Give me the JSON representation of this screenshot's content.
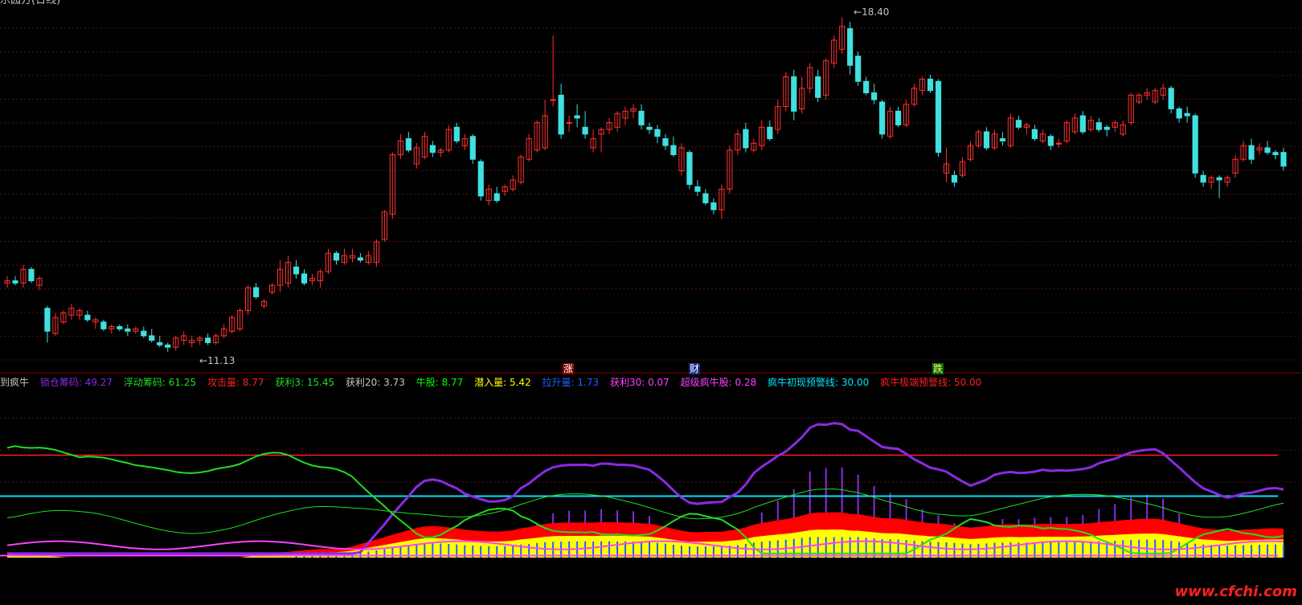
{
  "app": {
    "title": "乐园方(日线)",
    "watermark": "www.cfchi.com"
  },
  "colors": {
    "background": "#000000",
    "grid": "#5a1010",
    "separator": "#8b0000",
    "up_candle": "#ff3030",
    "down_candle": "#40e0e0",
    "lock_chip": "#8a2be2",
    "float_chip": "#22dd22",
    "profit20": "#c8c8c8",
    "bull_stock": "#00ff00",
    "hidden_inflow": "#ffff00",
    "lift_volume": "#1e60ff",
    "profit30": "#ff40ff",
    "warn_initial": "#00e5ff",
    "warn_extreme": "#ff2020",
    "fill_red": "#ff0000",
    "fill_yellow": "#ffff00"
  },
  "main": {
    "high_label": "18.40",
    "low_label": "11.13",
    "high_arrow": "←",
    "low_arrow": "←",
    "signals": [
      {
        "text": "涨",
        "bg": "#8b0000",
        "color": "#ffffff"
      },
      {
        "text": "财",
        "bg": "#1e2a8a",
        "color": "#ffffff"
      },
      {
        "text": "跌",
        "bg": "#0a6a0a",
        "color": "#ffff66"
      }
    ]
  },
  "indicator": {
    "legend": [
      {
        "text": "到疯牛",
        "color": "#c8c8c8"
      },
      {
        "text": "锁仓筹码: 49.27",
        "color": "#8a2be2"
      },
      {
        "text": "浮动筹码: 61.25",
        "color": "#22dd22"
      },
      {
        "text": "攻击量: 8.77",
        "color": "#ff2020"
      },
      {
        "text": "获利3: 15.45",
        "color": "#22dd22"
      },
      {
        "text": "获利20: 3.73",
        "color": "#c8c8c8"
      },
      {
        "text": "牛股: 8.77",
        "color": "#00ff00"
      },
      {
        "text": "潜入量: 5.42",
        "color": "#ffff00"
      },
      {
        "text": "拉升量: 1.73",
        "color": "#1e60ff"
      },
      {
        "text": "获利30: 0.07",
        "color": "#ff40ff"
      },
      {
        "text": "超级疯牛股: 0.28",
        "color": "#ff40ff"
      },
      {
        "text": "疯牛初现预警线: 30.00",
        "color": "#00e5ff"
      },
      {
        "text": "疯牛极端预警线: 50.00",
        "color": "#ff2020"
      }
    ]
  },
  "chart_data": [
    {
      "type": "candlestick",
      "title": "",
      "high_marker": 18.4,
      "low_marker": 11.13,
      "ylim": [
        10.8,
        18.6
      ],
      "bars_ohlc": [
        [
          12.6,
          12.75,
          12.5,
          12.65
        ],
        [
          12.65,
          12.75,
          12.55,
          12.6
        ],
        [
          12.6,
          13.0,
          12.5,
          12.9
        ],
        [
          12.9,
          12.95,
          12.6,
          12.65
        ],
        [
          12.55,
          12.75,
          12.45,
          12.7
        ],
        [
          12.05,
          12.1,
          11.3,
          11.55
        ],
        [
          11.5,
          11.95,
          11.45,
          11.85
        ],
        [
          11.75,
          12.0,
          11.7,
          11.95
        ],
        [
          11.9,
          12.15,
          11.8,
          12.05
        ],
        [
          11.9,
          12.05,
          11.8,
          12.0
        ],
        [
          11.9,
          12.0,
          11.75,
          11.8
        ],
        [
          11.75,
          11.85,
          11.6,
          11.8
        ],
        [
          11.75,
          11.8,
          11.55,
          11.6
        ],
        [
          11.6,
          11.7,
          11.5,
          11.65
        ],
        [
          11.65,
          11.7,
          11.55,
          11.6
        ],
        [
          11.6,
          11.7,
          11.45,
          11.55
        ],
        [
          11.55,
          11.65,
          11.5,
          11.6
        ],
        [
          11.55,
          11.65,
          11.4,
          11.45
        ],
        [
          11.45,
          11.6,
          11.3,
          11.35
        ],
        [
          11.3,
          11.45,
          11.2,
          11.25
        ],
        [
          11.25,
          11.3,
          11.1,
          11.2
        ],
        [
          11.2,
          11.45,
          11.13,
          11.4
        ],
        [
          11.35,
          11.55,
          11.25,
          11.45
        ],
        [
          11.3,
          11.45,
          11.2,
          11.35
        ],
        [
          11.35,
          11.45,
          11.25,
          11.4
        ],
        [
          11.4,
          11.5,
          11.25,
          11.3
        ],
        [
          11.3,
          11.5,
          11.25,
          11.45
        ],
        [
          11.45,
          11.7,
          11.4,
          11.6
        ],
        [
          11.55,
          11.9,
          11.5,
          11.85
        ],
        [
          11.6,
          12.05,
          11.55,
          12.0
        ],
        [
          12.0,
          12.55,
          11.9,
          12.5
        ],
        [
          12.5,
          12.6,
          12.25,
          12.3
        ],
        [
          12.1,
          12.25,
          12.05,
          12.2
        ],
        [
          12.4,
          12.6,
          12.35,
          12.55
        ],
        [
          12.55,
          13.1,
          12.4,
          12.9
        ],
        [
          12.6,
          13.2,
          12.5,
          13.05
        ],
        [
          12.95,
          13.1,
          12.7,
          12.8
        ],
        [
          12.8,
          12.9,
          12.55,
          12.6
        ],
        [
          12.65,
          12.8,
          12.55,
          12.7
        ],
        [
          12.65,
          12.9,
          12.5,
          12.85
        ],
        [
          12.85,
          13.35,
          12.8,
          13.25
        ],
        [
          13.25,
          13.3,
          13.0,
          13.1
        ],
        [
          13.05,
          13.35,
          13.0,
          13.2
        ],
        [
          13.15,
          13.35,
          13.05,
          13.2
        ],
        [
          13.15,
          13.25,
          13.05,
          13.1
        ],
        [
          13.05,
          13.3,
          13.0,
          13.2
        ],
        [
          13.05,
          13.55,
          12.95,
          13.5
        ],
        [
          13.55,
          14.2,
          13.5,
          14.15
        ],
        [
          14.1,
          15.45,
          14.0,
          15.4
        ],
        [
          15.4,
          15.85,
          15.3,
          15.7
        ],
        [
          15.75,
          15.9,
          15.45,
          15.5
        ],
        [
          15.2,
          15.65,
          15.1,
          15.55
        ],
        [
          15.35,
          15.9,
          15.3,
          15.8
        ],
        [
          15.6,
          15.7,
          15.35,
          15.45
        ],
        [
          15.45,
          15.55,
          15.35,
          15.5
        ],
        [
          15.5,
          16.05,
          15.45,
          15.95
        ],
        [
          16.0,
          16.1,
          15.65,
          15.7
        ],
        [
          15.6,
          15.85,
          15.5,
          15.75
        ],
        [
          15.8,
          15.85,
          15.2,
          15.3
        ],
        [
          15.25,
          15.3,
          14.4,
          14.5
        ],
        [
          14.4,
          14.75,
          14.3,
          14.65
        ],
        [
          14.55,
          14.7,
          14.35,
          14.4
        ],
        [
          14.6,
          14.75,
          14.5,
          14.7
        ],
        [
          14.65,
          14.95,
          14.6,
          14.85
        ],
        [
          14.8,
          15.4,
          14.75,
          15.35
        ],
        [
          15.3,
          15.85,
          15.25,
          15.75
        ],
        [
          15.5,
          16.15,
          15.45,
          16.1
        ],
        [
          15.55,
          16.6,
          15.5,
          16.25
        ],
        [
          16.6,
          18.0,
          16.45,
          16.6
        ],
        [
          16.7,
          16.95,
          15.75,
          15.85
        ],
        [
          16.1,
          16.25,
          15.9,
          16.1
        ],
        [
          16.25,
          16.5,
          16.0,
          16.2
        ],
        [
          16.0,
          16.35,
          15.75,
          15.85
        ],
        [
          15.55,
          15.95,
          15.45,
          15.75
        ],
        [
          15.85,
          16.0,
          15.45,
          15.95
        ],
        [
          15.95,
          16.2,
          15.85,
          16.1
        ],
        [
          16.0,
          16.35,
          15.9,
          16.3
        ],
        [
          16.2,
          16.45,
          16.05,
          16.35
        ],
        [
          16.35,
          16.5,
          16.2,
          16.4
        ],
        [
          16.35,
          16.5,
          15.95,
          16.05
        ],
        [
          16.0,
          16.1,
          15.85,
          15.95
        ],
        [
          15.95,
          16.05,
          15.65,
          15.8
        ],
        [
          15.75,
          15.85,
          15.5,
          15.6
        ],
        [
          15.6,
          15.8,
          15.35,
          15.4
        ],
        [
          15.05,
          15.65,
          14.95,
          15.55
        ],
        [
          15.45,
          15.5,
          14.65,
          14.75
        ],
        [
          14.7,
          14.85,
          14.5,
          14.6
        ],
        [
          14.55,
          14.65,
          14.3,
          14.35
        ],
        [
          14.35,
          14.45,
          14.1,
          14.2
        ],
        [
          14.2,
          14.75,
          14.0,
          14.65
        ],
        [
          14.65,
          15.6,
          14.55,
          15.5
        ],
        [
          15.5,
          15.95,
          15.4,
          15.85
        ],
        [
          15.95,
          16.1,
          15.45,
          15.55
        ],
        [
          15.5,
          15.75,
          15.45,
          15.65
        ],
        [
          15.6,
          16.15,
          15.5,
          16.0
        ],
        [
          16.0,
          16.15,
          15.7,
          15.75
        ],
        [
          15.95,
          16.6,
          15.85,
          16.45
        ],
        [
          16.45,
          17.2,
          16.35,
          17.1
        ],
        [
          17.1,
          17.25,
          16.15,
          16.35
        ],
        [
          16.4,
          17.1,
          16.3,
          16.85
        ],
        [
          16.85,
          17.4,
          16.75,
          17.3
        ],
        [
          17.1,
          17.25,
          16.55,
          16.65
        ],
        [
          16.7,
          17.5,
          16.6,
          17.45
        ],
        [
          17.4,
          18.0,
          17.3,
          17.9
        ],
        [
          17.7,
          18.4,
          17.6,
          18.2
        ],
        [
          18.15,
          18.3,
          17.15,
          17.35
        ],
        [
          17.55,
          17.65,
          16.9,
          17.0
        ],
        [
          17.0,
          17.1,
          16.7,
          16.75
        ],
        [
          16.75,
          16.95,
          16.5,
          16.6
        ],
        [
          16.55,
          16.6,
          15.75,
          15.85
        ],
        [
          15.8,
          16.45,
          15.75,
          16.35
        ],
        [
          16.35,
          16.45,
          16.0,
          16.05
        ],
        [
          16.05,
          16.6,
          16.0,
          16.5
        ],
        [
          16.5,
          16.95,
          16.45,
          16.85
        ],
        [
          16.8,
          17.1,
          16.7,
          17.05
        ],
        [
          17.05,
          17.15,
          16.75,
          16.8
        ],
        [
          17.0,
          17.05,
          15.35,
          15.45
        ],
        [
          15.0,
          15.55,
          14.8,
          15.2
        ],
        [
          14.95,
          15.05,
          14.7,
          14.8
        ],
        [
          14.95,
          15.35,
          14.9,
          15.25
        ],
        [
          15.3,
          15.7,
          15.25,
          15.6
        ],
        [
          15.6,
          15.95,
          15.55,
          15.9
        ],
        [
          15.9,
          16.0,
          15.5,
          15.55
        ],
        [
          15.55,
          15.95,
          15.5,
          15.85
        ],
        [
          15.75,
          15.9,
          15.6,
          15.7
        ],
        [
          15.6,
          16.3,
          15.55,
          16.2
        ],
        [
          16.15,
          16.25,
          15.95,
          16.0
        ],
        [
          16.0,
          16.1,
          15.85,
          16.05
        ],
        [
          15.95,
          16.05,
          15.7,
          15.75
        ],
        [
          15.7,
          15.95,
          15.65,
          15.85
        ],
        [
          15.8,
          15.85,
          15.5,
          15.6
        ],
        [
          15.65,
          15.75,
          15.55,
          15.65
        ],
        [
          15.7,
          16.15,
          15.65,
          16.1
        ],
        [
          15.9,
          16.3,
          15.85,
          16.2
        ],
        [
          16.25,
          16.35,
          15.85,
          15.9
        ],
        [
          15.95,
          16.25,
          15.9,
          16.15
        ],
        [
          16.1,
          16.2,
          15.9,
          15.95
        ],
        [
          16.0,
          16.05,
          15.8,
          15.95
        ],
        [
          16.0,
          16.15,
          15.9,
          16.1
        ],
        [
          15.85,
          16.15,
          15.8,
          16.05
        ],
        [
          16.1,
          16.75,
          16.05,
          16.7
        ],
        [
          16.55,
          16.75,
          16.5,
          16.7
        ],
        [
          16.7,
          16.85,
          16.6,
          16.75
        ],
        [
          16.55,
          16.85,
          16.5,
          16.8
        ],
        [
          16.7,
          16.95,
          16.6,
          16.85
        ],
        [
          16.85,
          16.9,
          16.3,
          16.4
        ],
        [
          16.4,
          16.45,
          16.1,
          16.2
        ],
        [
          16.3,
          16.45,
          16.1,
          16.25
        ],
        [
          16.25,
          16.3,
          14.9,
          15.0
        ],
        [
          14.95,
          15.05,
          14.7,
          14.8
        ],
        [
          14.8,
          14.95,
          14.65,
          14.9
        ],
        [
          14.9,
          14.95,
          14.45,
          14.85
        ],
        [
          14.8,
          14.95,
          14.7,
          14.9
        ],
        [
          15.0,
          15.4,
          14.9,
          15.3
        ],
        [
          15.3,
          15.7,
          15.25,
          15.6
        ],
        [
          15.6,
          15.75,
          15.2,
          15.3
        ],
        [
          15.5,
          15.65,
          15.4,
          15.55
        ],
        [
          15.55,
          15.7,
          15.4,
          15.45
        ],
        [
          15.45,
          15.5,
          15.3,
          15.4
        ],
        [
          15.45,
          15.55,
          15.05,
          15.15
        ]
      ]
    },
    {
      "type": "indicator",
      "title": "",
      "ylim": [
        0,
        80
      ],
      "reference_lines": [
        {
          "name": "疯牛初现预警线",
          "value": 30
        },
        {
          "name": "疯牛极端预警线",
          "value": 50
        }
      ],
      "series": [
        {
          "name": "锁仓筹码",
          "values": [
            45,
            44.5,
            44,
            43.5,
            43,
            42.5,
            42,
            41.5,
            41,
            40.5,
            40,
            39.5,
            39,
            38.5,
            38,
            37.5,
            37,
            36.5,
            36,
            35.5,
            35,
            34.5,
            34,
            33.5,
            33,
            32.5,
            32,
            31.5,
            31,
            30.5,
            30,
            29.5,
            29,
            28.5,
            28,
            27.5,
            27,
            26.5,
            26,
            25.5,
            25,
            24.5,
            24,
            23.5,
            23,
            22.5,
            22,
            21.5,
            21,
            20.5,
            20,
            19.5,
            19,
            18.5,
            18,
            17.5,
            17,
            16.5,
            16,
            15.5,
            15,
            14.5,
            14,
            13.5,
            13,
            12.5,
            12,
            11.5,
            11,
            10.5,
            10,
            9.5,
            9,
            8.5,
            8,
            7.5,
            7,
            6.5,
            6,
            5.5,
            5,
            4.5,
            4,
            3.5,
            3,
            2.5,
            2,
            1.5,
            1,
            0.5,
            0,
            0,
            0,
            0,
            0,
            0,
            0,
            0,
            0,
            0,
            0,
            0,
            0,
            0,
            0,
            0,
            0,
            0,
            0,
            0,
            0,
            0,
            0,
            0,
            0,
            0,
            0,
            0,
            0,
            0,
            0,
            0,
            0,
            0,
            0,
            0,
            0,
            0,
            0,
            0,
            0,
            0,
            0,
            0,
            0,
            0,
            0,
            0,
            0,
            0,
            0,
            0,
            0,
            0,
            0,
            0,
            0,
            0,
            0,
            0
          ]
        }
      ],
      "note_values": {
        "锁仓筹码": 49.27,
        "浮动筹码": 61.25,
        "攻击量": 8.77,
        "获利3": 15.45,
        "获利20": 3.73,
        "牛股": 8.77,
        "潜入量": 5.42,
        "拉升量": 1.73,
        "获利30": 0.07,
        "超级疯牛股": 0.28
      }
    }
  ]
}
